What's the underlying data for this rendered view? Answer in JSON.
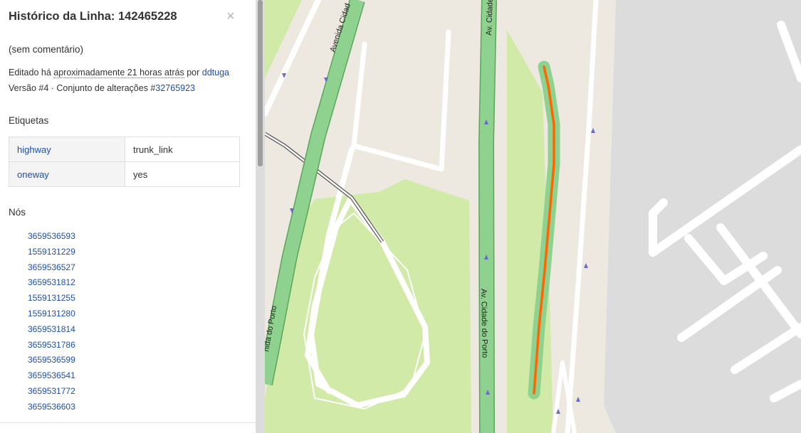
{
  "sidebar": {
    "title": "Histórico da Linha: 142465228",
    "close_label": "×",
    "comment": "(sem comentário)",
    "edited_prefix": "Editado há",
    "edited_time": "aproximadamente 21 horas atrás",
    "edited_by_word": "por",
    "edited_user": "ddtuga",
    "version_prefix": "Versão #4 · Conjunto de alterações #",
    "changeset_id": "32765923",
    "tags_heading": "Etiquetas",
    "tags": [
      {
        "key": "highway",
        "value": "trunk_link"
      },
      {
        "key": "oneway",
        "value": "yes"
      }
    ],
    "nodes_heading": "Nós",
    "nodes": [
      "3659536593",
      "1559131229",
      "3659536527",
      "3659531812",
      "1559131255",
      "1559131280",
      "3659531814",
      "3659531786",
      "3659536599",
      "3659536541",
      "3659531772",
      "3659536603"
    ]
  },
  "map": {
    "road_labels": [
      "Avenida Cidad",
      "Av. Cidade",
      "Av. Cidade do Porto",
      "nida do Porto"
    ],
    "colors": {
      "background": "#ede9e0",
      "park": "#d2eaa8",
      "trunk": "#8fd18f",
      "highlight": "#ff6600",
      "industrial": "#dcdcdc",
      "road": "#ffffff"
    }
  }
}
